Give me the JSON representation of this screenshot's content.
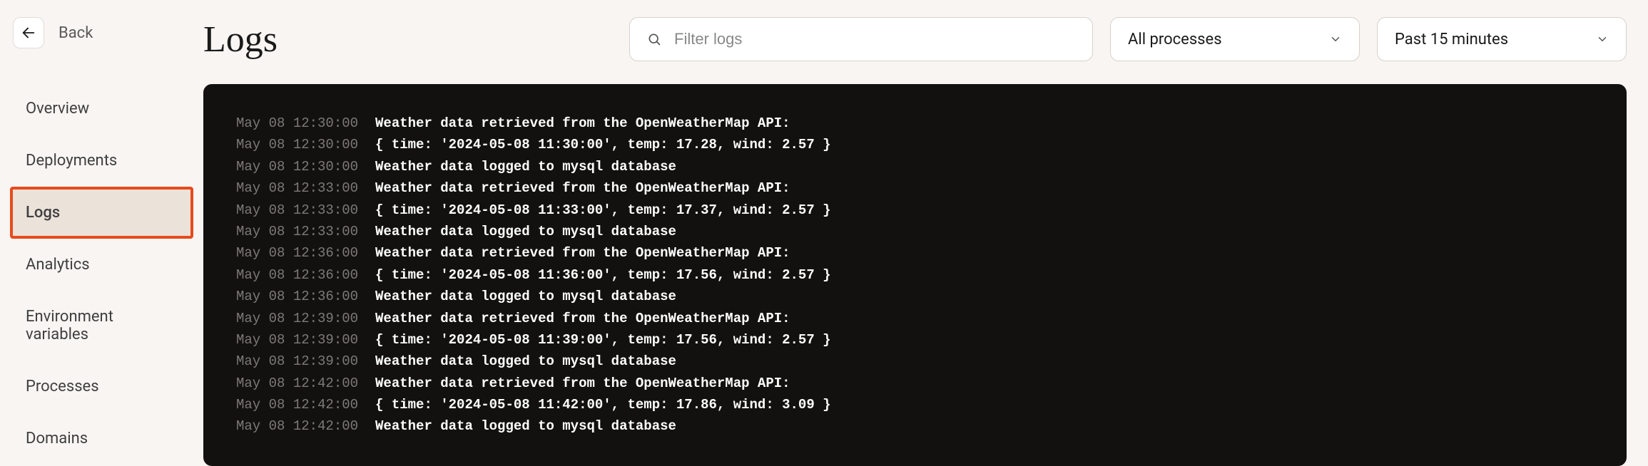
{
  "back": {
    "label": "Back"
  },
  "sidebar": {
    "items": [
      {
        "label": "Overview"
      },
      {
        "label": "Deployments"
      },
      {
        "label": "Logs",
        "active": true
      },
      {
        "label": "Analytics"
      },
      {
        "label": "Environment variables"
      },
      {
        "label": "Processes"
      },
      {
        "label": "Domains"
      }
    ]
  },
  "header": {
    "title": "Logs",
    "search": {
      "placeholder": "Filter logs",
      "value": ""
    },
    "process_filter": {
      "label": "All processes"
    },
    "time_filter": {
      "label": "Past 15 minutes"
    }
  },
  "logs": [
    {
      "ts": "May 08 12:30:00",
      "msg": "Weather data retrieved from the OpenWeatherMap API:"
    },
    {
      "ts": "May 08 12:30:00",
      "msg": "{ time: '2024-05-08 11:30:00', temp: 17.28, wind: 2.57 }"
    },
    {
      "ts": "May 08 12:30:00",
      "msg": "Weather data logged to mysql database"
    },
    {
      "ts": "May 08 12:33:00",
      "msg": "Weather data retrieved from the OpenWeatherMap API:"
    },
    {
      "ts": "May 08 12:33:00",
      "msg": "{ time: '2024-05-08 11:33:00', temp: 17.37, wind: 2.57 }"
    },
    {
      "ts": "May 08 12:33:00",
      "msg": "Weather data logged to mysql database"
    },
    {
      "ts": "May 08 12:36:00",
      "msg": "Weather data retrieved from the OpenWeatherMap API:"
    },
    {
      "ts": "May 08 12:36:00",
      "msg": "{ time: '2024-05-08 11:36:00', temp: 17.56, wind: 2.57 }"
    },
    {
      "ts": "May 08 12:36:00",
      "msg": "Weather data logged to mysql database"
    },
    {
      "ts": "May 08 12:39:00",
      "msg": "Weather data retrieved from the OpenWeatherMap API:"
    },
    {
      "ts": "May 08 12:39:00",
      "msg": "{ time: '2024-05-08 11:39:00', temp: 17.56, wind: 2.57 }"
    },
    {
      "ts": "May 08 12:39:00",
      "msg": "Weather data logged to mysql database"
    },
    {
      "ts": "May 08 12:42:00",
      "msg": "Weather data retrieved from the OpenWeatherMap API:"
    },
    {
      "ts": "May 08 12:42:00",
      "msg": "{ time: '2024-05-08 11:42:00', temp: 17.86, wind: 3.09 }"
    },
    {
      "ts": "May 08 12:42:00",
      "msg": "Weather data logged to mysql database"
    }
  ]
}
